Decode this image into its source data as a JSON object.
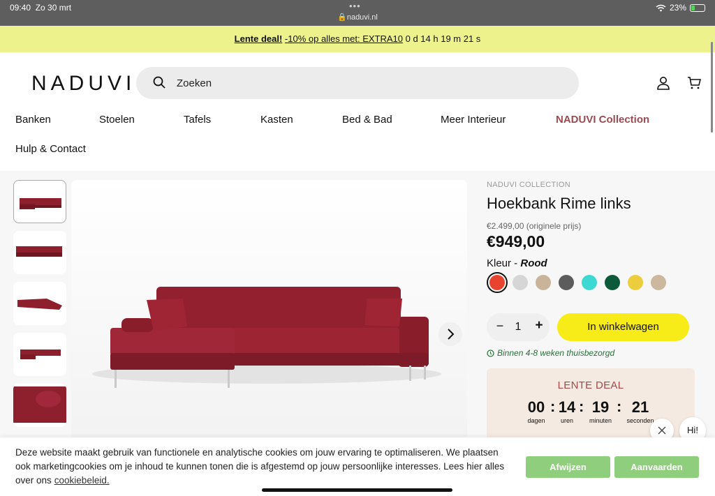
{
  "status_bar": {
    "time": "09:40",
    "date": "Zo 30 mrt",
    "dots": "•••",
    "url": "naduvi.nl",
    "battery": "23%"
  },
  "promo": {
    "deal_title": "Lente deal!",
    "deal_text": "-10% op alles met: EXTRA10",
    "countdown": "0 d 14 h 19 m 21 s"
  },
  "header": {
    "logo": "NADUVI",
    "search_placeholder": "Zoeken"
  },
  "nav": {
    "items": [
      "Banken",
      "Stoelen",
      "Tafels",
      "Kasten",
      "Bed & Bad",
      "Meer Interieur",
      "NADUVI Collection",
      "Hulp & Contact"
    ]
  },
  "product": {
    "eyebrow": "NADUVI COLLECTION",
    "title": "Hoekbank Rime links",
    "original_price": "€2.499,00 (originele prijs)",
    "price": "€949,00",
    "color_label": "Kleur - ",
    "color_name": "Rood",
    "swatches": [
      "#e8432e",
      "#d6d6d6",
      "#c9b49a",
      "#5c5c5c",
      "#3ed8d3",
      "#0c5a3a",
      "#ecce3c",
      "#cbb89d"
    ],
    "quantity": "1",
    "minus": "−",
    "plus": "+",
    "add_to_cart": "In winkelwagen",
    "delivery": "Binnen 4-8 weken thuisbezorgd"
  },
  "deal_box": {
    "heading": "LENTE DEAL",
    "days": "00",
    "days_label": "dagen",
    "hours": "14",
    "hours_label": "uren",
    "minutes": "19",
    "minutes_label": "minuten",
    "seconds": "21",
    "seconds_label": "seconden",
    "sep": ":"
  },
  "chat": {
    "hi": "Hi!"
  },
  "cookie": {
    "text": "Deze website maakt gebruik van functionele en analytische cookies om jouw ervaring te optimaliseren. We plaatsen ook marketingcookies om je inhoud te kunnen tonen die is afgestemd op jouw persoonlijke interesses. Lees hier alles over ons",
    "link": "cookiebeleid.",
    "decline": "Afwijzen",
    "accept": "Aanvaarden"
  },
  "colors": {
    "promo_bg": "#eef28c",
    "brand": "#9b4b52",
    "cta": "#f7ec18",
    "cookie_btn": "#8fce7d",
    "sofa": "#8e1f2c"
  }
}
